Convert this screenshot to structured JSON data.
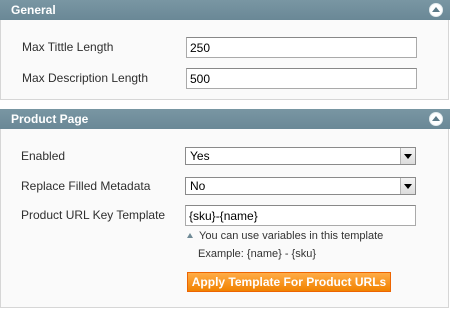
{
  "general": {
    "title": "General",
    "fields": [
      {
        "label": "Max Tittle Length",
        "value": "250"
      },
      {
        "label": "Max Description Length",
        "value": "500"
      }
    ]
  },
  "product_page": {
    "title": "Product Page",
    "enabled": {
      "label": "Enabled",
      "value": "Yes"
    },
    "replace_metadata": {
      "label": "Replace Filled Metadata",
      "value": "No"
    },
    "url_key_template": {
      "label": "Product URL Key Template",
      "value": "{sku}-{name}"
    },
    "note_line1": "You can use variables in this template",
    "note_line2": "Example: {name} - {sku}",
    "apply_button": "Apply Template For Product URLs"
  },
  "colors": {
    "header_bg": "#7391a0",
    "button_bg": "#f18200"
  },
  "icons": {
    "collapse": "chevron-up-icon",
    "dropdown": "chevron-down-icon"
  }
}
